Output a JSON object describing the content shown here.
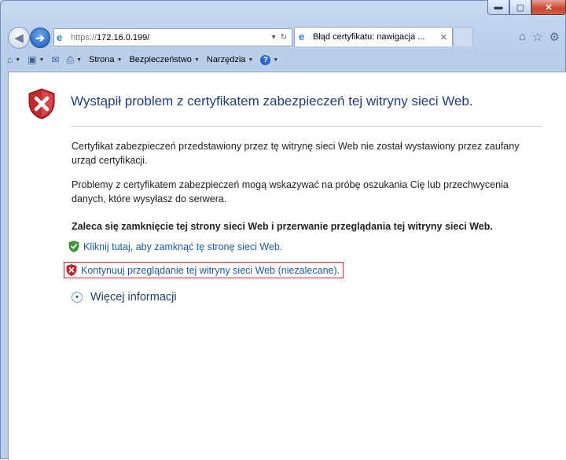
{
  "window": {
    "min_label": "▬",
    "max_label": "▢",
    "close_label": "✕"
  },
  "nav": {
    "back_icon": "◀",
    "forward_icon": "➔",
    "url_proto": "https://",
    "url_host": "172.16.0.199/",
    "dropdown_icon": "▾",
    "refresh_icon": "↻",
    "tab_title": "Błąd certyfikatu: nawigacja ...",
    "tab_close": "✕",
    "home_icon": "⌂",
    "favorites_icon": "☆",
    "tools_icon": "⚙"
  },
  "commandbar": {
    "page_label": "Strona",
    "safety_label": "Bezpieczeństwo",
    "tools_label": "Narzędzia",
    "help_label": "?",
    "arrow": "▼"
  },
  "content": {
    "heading": "Wystąpił problem z certyfikatem zabezpieczeń tej witryny sieci Web.",
    "para1": "Certyfikat zabezpieczeń przedstawiony przez tę witrynę sieci Web nie został wystawiony przez zaufany urząd certyfikacji.",
    "para2": "Problemy z certyfikatem zabezpieczeń mogą wskazywać na próbę oszukania Cię lub przechwycenia danych, które wysyłasz do serwera.",
    "recommend": "Zaleca się zamknięcie tej strony sieci Web i przerwanie przeglądania tej witryny sieci Web.",
    "close_link": "Kliknij tutaj, aby zamknąć tę stronę sieci Web.",
    "continue_link": "Kontynuuj przeglądanie tej witryny sieci Web (niezalecane).",
    "more_info": "Więcej informacji"
  },
  "colors": {
    "link": "#1a5aa0",
    "heading": "#1f3f73",
    "highlight": "#e0212b"
  }
}
